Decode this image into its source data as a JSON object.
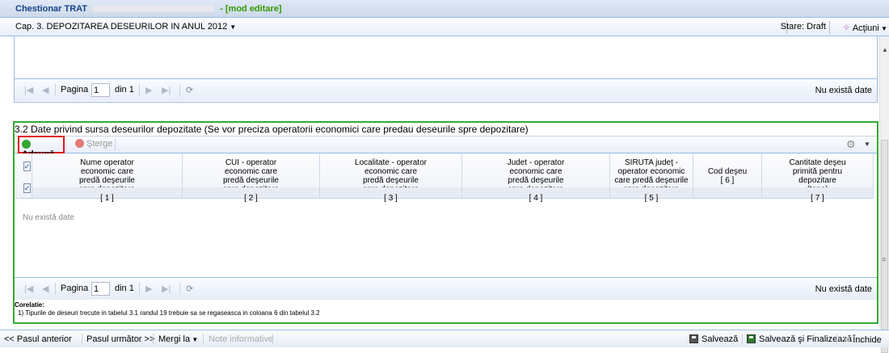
{
  "window": {
    "title": "Chestionar TRAT",
    "mode": "- [mod editare]"
  },
  "chapter": {
    "label": "Cap. 3. DEPOZITAREA DESEURILOR IN ANUL 2012",
    "status": "Stare: Draft",
    "actions": "Acţiuni"
  },
  "top_grid": {
    "pager": {
      "page_label": "Pagina",
      "page_value": "1",
      "of_label": "din 1",
      "no_data": "Nu există date"
    }
  },
  "section": {
    "title": "3.2 Date privind sursa deseurilor depozitate (Se vor preciza operatorii economici care predau deseurile spre depozitare)",
    "add_label": "Adaugă",
    "delete_label": "Şterge",
    "columns": [
      {
        "lines": [
          "Nume operator",
          "economic care",
          "predă deşeurile",
          "spre depozitare"
        ],
        "num": "[ 1 ]"
      },
      {
        "lines": [
          "CUI - operator",
          "economic care",
          "predă deşeurile",
          "spre depozitare"
        ],
        "num": "[ 2 ]"
      },
      {
        "lines": [
          "Localitate - operator",
          "economic care",
          "predă deşeurile",
          "spre depozitare"
        ],
        "num": "[ 3 ]"
      },
      {
        "lines": [
          "Judet - operator",
          "economic care",
          "predă deşeurile",
          "spre depozitare"
        ],
        "num": "[ 4 ]"
      },
      {
        "lines": [
          "SIRUTA judeţ -",
          "operator economic",
          "care predă deşeurile",
          "spre depozitare"
        ],
        "num": "[ 5 ]"
      },
      {
        "lines": [
          "Cod deşeu"
        ],
        "num": "[ 6 ]"
      },
      {
        "lines": [
          "Cantitate deşeu",
          "primită pentru",
          "depozitare",
          "(tone)"
        ],
        "num": "[ 7 ]"
      }
    ],
    "empty_text": "Nu există date",
    "pager": {
      "page_label": "Pagina",
      "page_value": "1",
      "of_label": "din 1",
      "no_data": "Nu există date"
    },
    "correlation_title": "Corelatie:",
    "correlation_text": "1) Tipurile de deseuri trecute in tabelul 3.1 randul 19 trebuie sa se regaseasca in coloana 6 din tabelul 3.2"
  },
  "bottom": {
    "prev": "<< Pasul anterior",
    "next": "Pasul următor >>",
    "goto": "Mergi la",
    "notes": "Note informative",
    "save": "Salvează",
    "save_finalize": "Salvează şi Finalizează",
    "close": "Închide"
  }
}
